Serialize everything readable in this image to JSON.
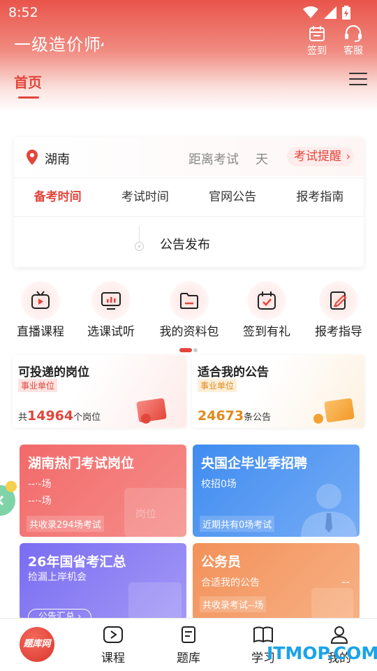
{
  "status": {
    "time": "8:52"
  },
  "header": {
    "title": "一级造价师",
    "checkin_label": "签到",
    "service_label": "客服"
  },
  "nav": {
    "home_tab": "首页"
  },
  "exam_card": {
    "region": "湖南",
    "countdown_label": "距离考试",
    "countdown_unit": "天",
    "remind_label": "考试提醒",
    "tabs": [
      "备考时间",
      "考试时间",
      "官网公告",
      "报考指南"
    ],
    "active_tab": 0,
    "timeline_text": "公告发布"
  },
  "quick_nav": [
    {
      "label": "直播课程",
      "icon": "tv-play-icon"
    },
    {
      "label": "选课试听",
      "icon": "monitor-chart-icon"
    },
    {
      "label": "我的资料包",
      "icon": "folder-icon"
    },
    {
      "label": "签到有礼",
      "icon": "calendar-check-icon"
    },
    {
      "label": "报考指导",
      "icon": "edit-document-icon"
    }
  ],
  "promos": [
    {
      "title": "可投递的岗位",
      "tag": "事业单位",
      "prefix": "共",
      "count": "14964",
      "suffix": "个岗位"
    },
    {
      "title": "适合我的公告",
      "tag": "事业单位",
      "prefix": "",
      "count": "24673",
      "suffix": "条公告"
    }
  ],
  "cards": {
    "hunan": {
      "title": "湖南热门考试岗位",
      "line1": "--·-场",
      "line2": "--·-场",
      "footer": "共收录294场考试",
      "deco": "岗位"
    },
    "soe": {
      "title": "央国企毕业季招聘",
      "line1": "校招0场",
      "footer": "近期共有0场考试"
    },
    "national": {
      "title": "26年国省考汇总",
      "line1": "捡漏上岸机会",
      "button": "公告汇总 ›"
    },
    "civil": {
      "title": "公务员",
      "line1": "合适我的公告",
      "value": "--",
      "footer": "共收录考试--场"
    }
  },
  "bottom_nav": {
    "logo_text": "题库网",
    "items": [
      "课程",
      "题库",
      "学习",
      "我的"
    ]
  },
  "watermark": "ITMOP.COM",
  "colors": {
    "primary": "#e2463b",
    "blue": "#3f8cf0",
    "purple": "#7a6df2",
    "orange": "#f3915a"
  }
}
